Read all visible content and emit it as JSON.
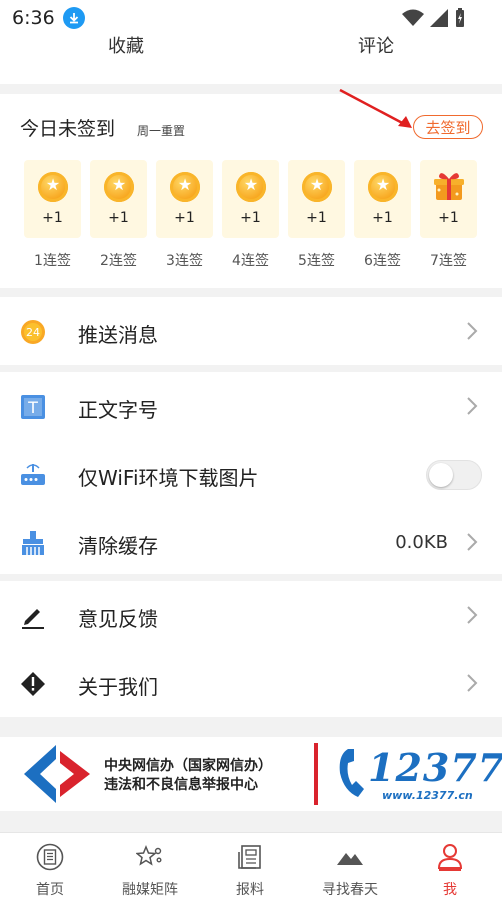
{
  "status": {
    "time": "6:36"
  },
  "top_tabs": [
    "收藏",
    "评论"
  ],
  "signin": {
    "title": "今日未签到",
    "subtitle": "周一重置",
    "button": "去签到",
    "days": [
      {
        "reward": "+1",
        "label": "1连签",
        "icon": "coin-icon"
      },
      {
        "reward": "+1",
        "label": "2连签",
        "icon": "coin-icon"
      },
      {
        "reward": "+1",
        "label": "3连签",
        "icon": "coin-icon"
      },
      {
        "reward": "+1",
        "label": "4连签",
        "icon": "coin-icon"
      },
      {
        "reward": "+1",
        "label": "5连签",
        "icon": "coin-icon"
      },
      {
        "reward": "+1",
        "label": "6连签",
        "icon": "coin-icon"
      },
      {
        "reward": "+1",
        "label": "7连签",
        "icon": "gift-icon"
      }
    ]
  },
  "settings": {
    "push": {
      "label": "推送消息",
      "icon_text": "24"
    },
    "font_size": {
      "label": "正文字号",
      "icon_text": "T"
    },
    "wifi_only": {
      "label": "仅WiFi环境下载图片",
      "enabled": false
    },
    "clear_cache": {
      "label": "清除缓存",
      "value": "0.0KB"
    },
    "feedback": {
      "label": "意见反馈"
    },
    "about": {
      "label": "关于我们"
    }
  },
  "banner": {
    "line1": "中央网信办（国家网信办）",
    "line2": "违法和不良信息举报中心",
    "number": "12377",
    "url": "www.12377.cn"
  },
  "tabbar": [
    {
      "label": "首页",
      "icon": "newspaper-icon",
      "active": false
    },
    {
      "label": "融媒矩阵",
      "icon": "stars-icon",
      "active": false
    },
    {
      "label": "报料",
      "icon": "report-icon",
      "active": false
    },
    {
      "label": "寻找春天",
      "icon": "mountain-icon",
      "active": false
    },
    {
      "label": "我",
      "icon": "user-icon",
      "active": true
    }
  ],
  "colors": {
    "accent": "#f06a2e",
    "active_tab": "#e53935",
    "brand_blue": "#1c6fc1",
    "arrow_red": "#e02020"
  }
}
